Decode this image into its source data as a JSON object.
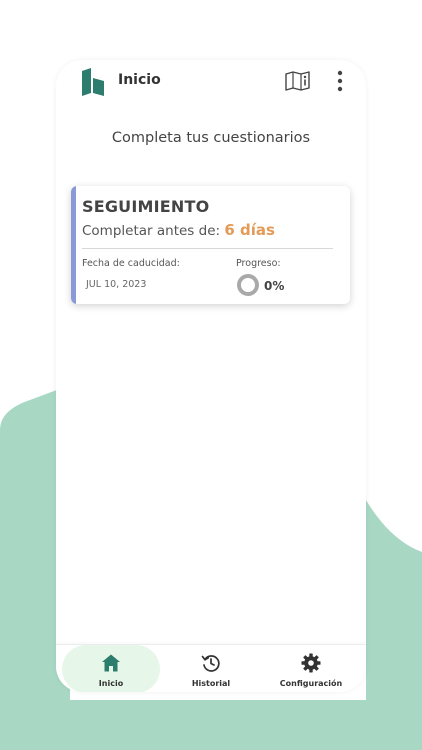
{
  "header": {
    "title": "Inicio",
    "logo_icon": "app-logo-icon",
    "map_icon": "map-info-icon",
    "menu_icon": "more-vertical-icon"
  },
  "main": {
    "subtitle": "Completa tus cuestionarios"
  },
  "card": {
    "title": "SEGUIMIENTO",
    "due_prefix": "Completar antes de:",
    "due_days": "6 días",
    "expiry_label": "Fecha de caducidad:",
    "expiry_value": "JUL 10, 2023",
    "progress_label": "Progreso:",
    "progress_value": "0%",
    "progress_fraction": 0
  },
  "bottom_nav": {
    "items": [
      {
        "label": "Inicio",
        "icon": "home-icon",
        "active": true
      },
      {
        "label": "Historial",
        "icon": "history-icon",
        "active": false
      },
      {
        "label": "Configuración",
        "icon": "gear-icon",
        "active": false
      }
    ]
  },
  "colors": {
    "brand": "#2d7d6f",
    "background_blob": "#a8d8c4",
    "card_accent": "#8a9ad6",
    "days_accent": "#e39b57",
    "nav_active": "#e6f6e8"
  }
}
